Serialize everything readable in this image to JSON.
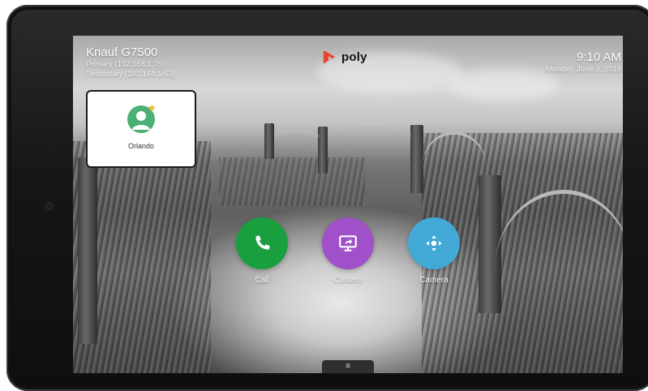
{
  "room": {
    "name": "Knauf G7500",
    "primary_ip": "Primary (192.168.1.75)",
    "secondary_ip": "Secondary (192.168.1.63)"
  },
  "brand": {
    "name": "poly",
    "logo_color": "#e8452c"
  },
  "clock": {
    "time": "9:10 AM",
    "date": "Monday, June 3, 2019"
  },
  "contact": {
    "name": "Orlando",
    "avatar_color": "#4caf74",
    "favorite_color": "#f2b021"
  },
  "actions": [
    {
      "label": "Call",
      "icon": "phone-icon",
      "color": "#1a9f3f"
    },
    {
      "label": "Content",
      "icon": "screen-share-icon",
      "color": "#a050c8"
    },
    {
      "label": "Camera",
      "icon": "camera-move-icon",
      "color": "#42a9d6"
    }
  ],
  "menu_handle": {
    "icon": "menu-icon",
    "glyph": "≡"
  }
}
